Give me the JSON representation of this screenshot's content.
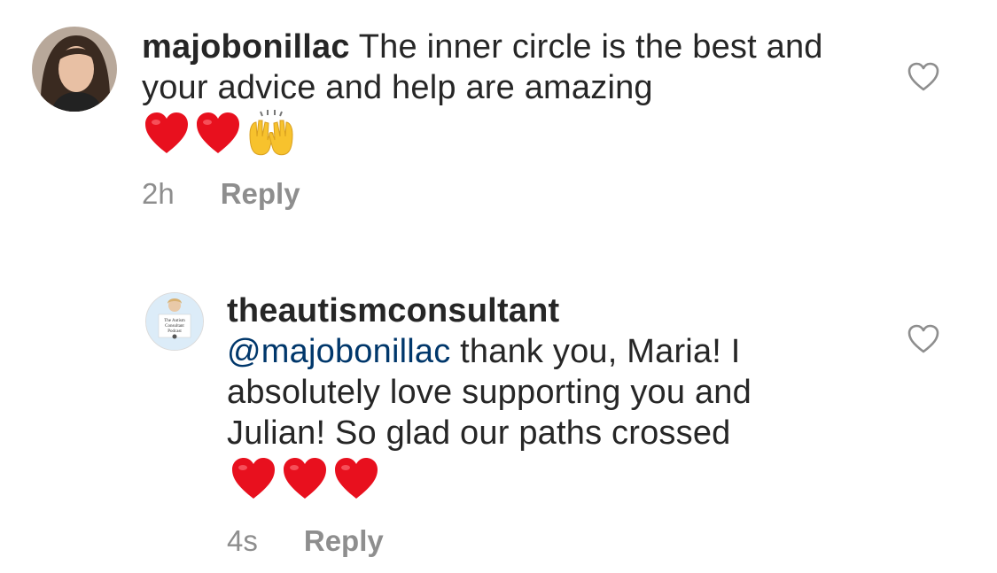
{
  "comments": [
    {
      "username": "majobonillac",
      "text": "The inner circle is the best and your advice and help are amazing",
      "emojis": [
        "heart-emoji",
        "heart-emoji",
        "raising-hands-emoji"
      ],
      "time": "2h",
      "reply_label": "Reply"
    },
    {
      "username": "theautismconsultant",
      "mention": "@majobonillac",
      "text": " thank you, Maria! I absolutely love supporting you and Julian! So glad our paths crossed",
      "emojis": [
        "heart-emoji",
        "heart-emoji",
        "heart-emoji"
      ],
      "time": "4s",
      "reply_label": "Reply",
      "avatar_caption": [
        "The Autism",
        "Consultant",
        "Podcast"
      ]
    }
  ],
  "colors": {
    "text": "#262626",
    "meta": "#8e8e8e",
    "mention": "#00376b",
    "heart_emoji": "#e8101e",
    "like_icon": "#8e8e8e"
  }
}
